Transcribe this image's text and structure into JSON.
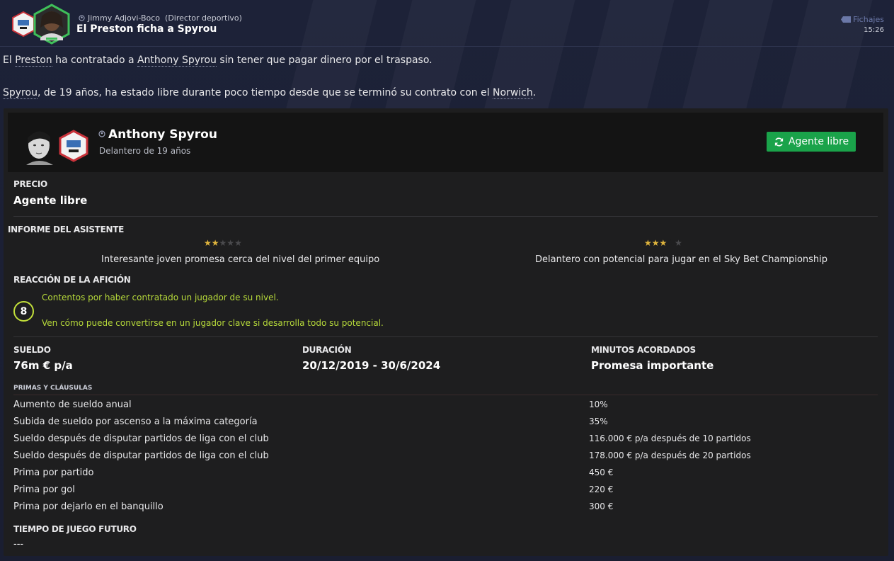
{
  "header": {
    "sender_name": "Jimmy Adjovi-Boco",
    "sender_role": "(Director deportivo)",
    "subject": "El Preston ficha a Spyrou",
    "tag": "Fichajes",
    "time": "15:26"
  },
  "message": {
    "p1": {
      "pre": "El ",
      "club": "Preston",
      "mid": " ha contratado a ",
      "player": "Anthony Spyrou",
      "post": " sin tener que pagar dinero por el traspaso."
    },
    "p2": {
      "player": "Spyrou",
      "mid": ", de 19 años, ha estado libre durante poco tiempo desde que se terminó su contrato con el ",
      "club": "Norwich",
      "post": "."
    }
  },
  "player": {
    "name": "Anthony Spyrou",
    "description": "Delantero de 19 años",
    "status_button": "Agente libre"
  },
  "price": {
    "label": "PRECIO",
    "value": "Agente libre"
  },
  "assistant_report": {
    "label": "INFORME DEL ASISTENTE",
    "items": [
      {
        "stars": 2,
        "text": "Interesante joven promesa cerca del nivel del primer equipo"
      },
      {
        "stars": 3,
        "text": "Delantero con potencial para jugar en el Sky Bet Championship"
      }
    ]
  },
  "fan_reaction": {
    "label": "REACCIÓN DE LA AFICIÓN",
    "score": "8",
    "line1": "Contentos por haber contratado un jugador de su nivel.",
    "line2": "Ven cómo puede convertirse en un jugador clave si desarrolla todo su potencial."
  },
  "contract": {
    "salary_label": "SUELDO",
    "salary_value": "76m € p/a",
    "duration_label": "DURACIÓN",
    "duration_value": "20/12/2019 - 30/6/2024",
    "minutes_label": "MINUTOS ACORDADOS",
    "minutes_value": "Promesa importante"
  },
  "bonuses": {
    "label": "PRIMAS Y CLÁUSULAS",
    "rows": [
      {
        "name": "Aumento de sueldo anual",
        "value": "10%"
      },
      {
        "name": "Subida de sueldo por ascenso a la máxima categoría",
        "value": "35%"
      },
      {
        "name": "Sueldo después de disputar partidos de liga con el club",
        "value": "116.000 € p/a después de 10 partidos"
      },
      {
        "name": "Sueldo después de disputar partidos de liga con el club",
        "value": "178.000 € p/a después de 20 partidos"
      },
      {
        "name": "Prima por partido",
        "value": "450 €"
      },
      {
        "name": "Prima por gol",
        "value": "220 €"
      },
      {
        "name": "Prima por dejarlo en el banquillo",
        "value": "300 €"
      }
    ]
  },
  "future_playing_time": {
    "label": "TIEMPO DE JUEGO FUTURO",
    "value": "---"
  },
  "colors": {
    "accent_green": "#1aa34a",
    "fan_text": "#b6d93a",
    "star_on": "#e0b53d",
    "star_off": "#4a4a4d"
  }
}
